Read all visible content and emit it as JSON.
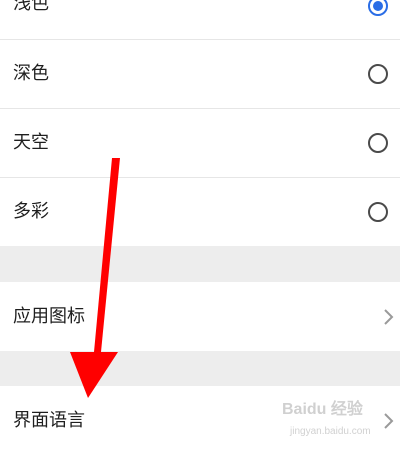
{
  "theme_options": [
    {
      "label": "浅色",
      "selected": true
    },
    {
      "label": "深色",
      "selected": false
    },
    {
      "label": "天空",
      "selected": false
    },
    {
      "label": "多彩",
      "selected": false
    }
  ],
  "app_icon_row": {
    "label": "应用图标"
  },
  "language_row": {
    "label": "界面语言"
  },
  "watermark": {
    "text": "Baidu 经验",
    "sub": "jingyan.baidu.com"
  },
  "colors": {
    "accent": "#2a6de6",
    "annotation_arrow": "#ff0000",
    "section_gap": "#ededed"
  },
  "icons": {
    "radio": "radio-button",
    "chevron": "chevron-right-icon",
    "arrow": "annotation-arrow"
  }
}
